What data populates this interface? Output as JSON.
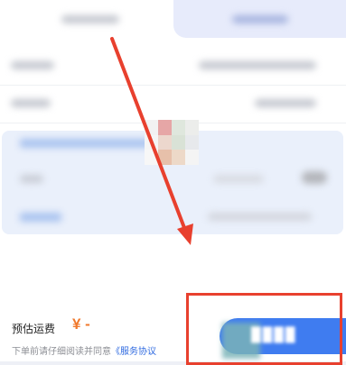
{
  "colors": {
    "accent": "#3f7cf0",
    "price": "#f0792c",
    "annotation": "#e8402e"
  },
  "footer": {
    "fee_label": "预估运费",
    "fee_value": "¥ -",
    "notice_prefix": "下单前请仔细阅读并同意",
    "notice_link": "《服务协议"
  },
  "submit": {
    "label": ""
  },
  "annotations": {
    "arrow": "red-arrow",
    "box": "red-highlight-box"
  }
}
